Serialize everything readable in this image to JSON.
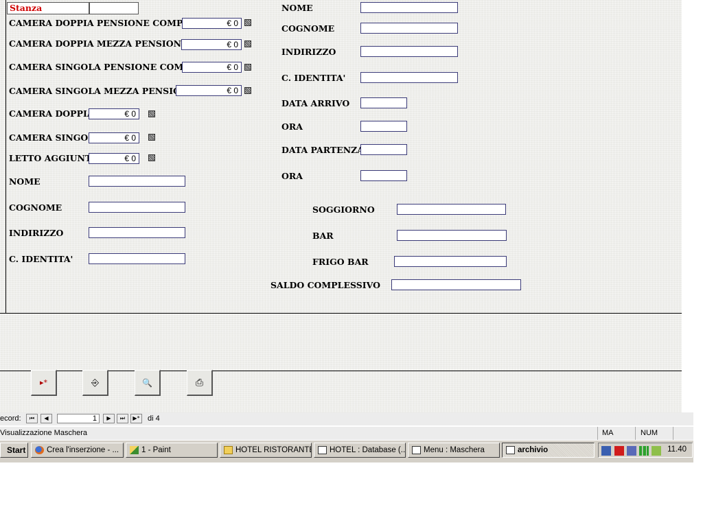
{
  "form": {
    "stanza_label": "Stanza",
    "stanza_value": "",
    "rates": [
      {
        "label": "CAMERA DOPPIA PENSIONE COMPLETA",
        "value": "€ 0"
      },
      {
        "label": "CAMERA DOPPIA MEZZA PENSIONE",
        "value": "€ 0"
      },
      {
        "label": "CAMERA SINGOLA PENSIONE COMPLETA",
        "value": "€ 0"
      },
      {
        "label": "CAMERA SINGOLA MEZZA PENSIONE",
        "value": "€ 0"
      },
      {
        "label": "CAMERA DOPPIA",
        "value": "€ 0"
      },
      {
        "label": "CAMERA SINGOLA",
        "value": "€ 0"
      },
      {
        "label": "LETTO AGGIUNTO",
        "value": "€ 0"
      }
    ],
    "guest1": {
      "nome_label": "NOME",
      "nome_value": "",
      "cognome_label": "COGNOME",
      "cognome_value": "",
      "indirizzo_label": "INDIRIZZO",
      "indirizzo_value": "",
      "identita_label": "C. IDENTITA'",
      "identita_value": ""
    },
    "guest2": {
      "nome_label": "NOME",
      "nome_value": "",
      "cognome_label": "COGNOME",
      "cognome_value": "",
      "indirizzo_label": "INDIRIZZO",
      "indirizzo_value": "",
      "identita_label": "C. IDENTITA'",
      "identita_value": ""
    },
    "dates": {
      "arrivo_label": "DATA ARRIVO",
      "arrivo_value": "",
      "ora1_label": "ORA",
      "ora1_value": "",
      "partenza_label": "DATA PARTENZA",
      "partenza_value": "",
      "ora2_label": "ORA",
      "ora2_value": ""
    },
    "totals": {
      "soggiorno_label": "SOGGIORNO",
      "soggiorno_value": "",
      "bar_label": "BAR",
      "bar_value": "",
      "frigo_label": "FRIGO BAR",
      "frigo_value": "",
      "saldo_label": "SALDO COMPLESSIVO",
      "saldo_value": ""
    }
  },
  "buttons": [
    {
      "icon": "new-record-icon",
      "glyph": "▸*"
    },
    {
      "icon": "exit-door-icon",
      "glyph": "⎆"
    },
    {
      "icon": "binoculars-icon",
      "glyph": "🔍"
    },
    {
      "icon": "printer-icon",
      "glyph": "⎙"
    }
  ],
  "record_nav": {
    "label": "ecord:",
    "current": "1",
    "of_text": "di 4",
    "first": "⏮",
    "prev": "◀",
    "next": "▶",
    "last": "⏭",
    "new": "▶*"
  },
  "status": {
    "text": "Visualizzazione Maschera",
    "ma": "MA",
    "num": "NUM"
  },
  "taskbar": {
    "start": "Start",
    "items": [
      {
        "label": "Crea l'inserzione - ...",
        "icon": "firefox-icon"
      },
      {
        "label": "1 - Paint",
        "icon": "paint-icon"
      },
      {
        "label": "HOTEL RISTORANTE",
        "icon": "folder-icon"
      },
      {
        "label": "HOTEL : Database (...",
        "icon": "database-icon"
      },
      {
        "label": "Menu : Maschera",
        "icon": "form-icon"
      },
      {
        "label": "archivio",
        "icon": "form-icon"
      }
    ],
    "clock": "11.40"
  },
  "colors": {
    "form_bg": "#efefec",
    "label_red": "#d00000",
    "field_border": "#3a3a78",
    "taskbar_bg": "#d4d0c8"
  }
}
